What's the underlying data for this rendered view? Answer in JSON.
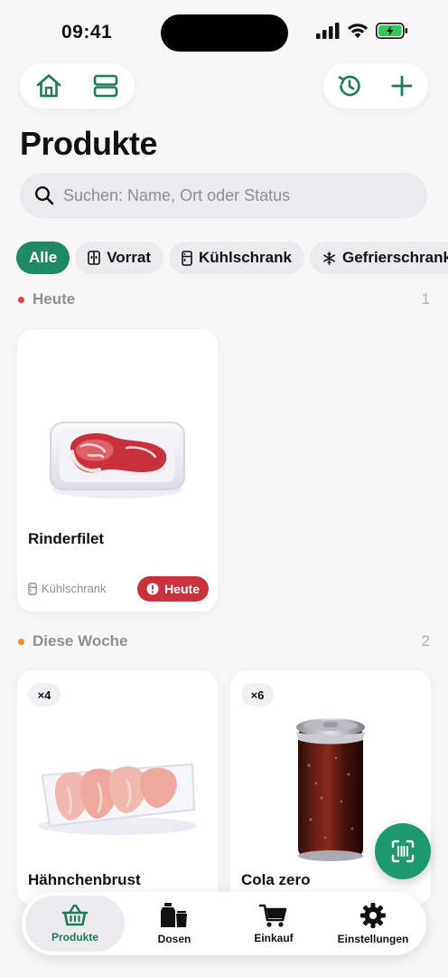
{
  "status_bar": {
    "time": "09:41"
  },
  "header": {
    "title": "Produkte"
  },
  "search": {
    "placeholder": "Suchen: Name, Ort oder Status"
  },
  "filters": [
    {
      "label": "Alle",
      "active": true
    },
    {
      "label": "Vorrat",
      "icon": "cabinet-icon"
    },
    {
      "label": "Kühlschrank",
      "icon": "fridge-icon"
    },
    {
      "label": "Gefrierschrank",
      "icon": "snowflake-icon"
    }
  ],
  "sections": [
    {
      "title": "Heute",
      "count": "1",
      "dot_color": "#e0423a",
      "items": [
        {
          "name": "Rinderfilet",
          "location": "Kühlschrank",
          "status": "Heute",
          "status_color": "#c8323c"
        }
      ]
    },
    {
      "title": "Diese Woche",
      "count": "2",
      "dot_color": "#f0902a",
      "items": [
        {
          "name": "Hähnchenbrust",
          "quantity": "×4"
        },
        {
          "name": "Cola zero",
          "quantity": "×6"
        }
      ]
    }
  ],
  "tab_bar": [
    {
      "label": "Produkte",
      "icon": "basket-icon",
      "active": true
    },
    {
      "label": "Dosen",
      "icon": "cans-icon"
    },
    {
      "label": "Einkauf",
      "icon": "cart-icon"
    },
    {
      "label": "Einstellungen",
      "icon": "gear-icon"
    }
  ],
  "colors": {
    "accent": "#1e8a63",
    "danger": "#c8323c"
  }
}
